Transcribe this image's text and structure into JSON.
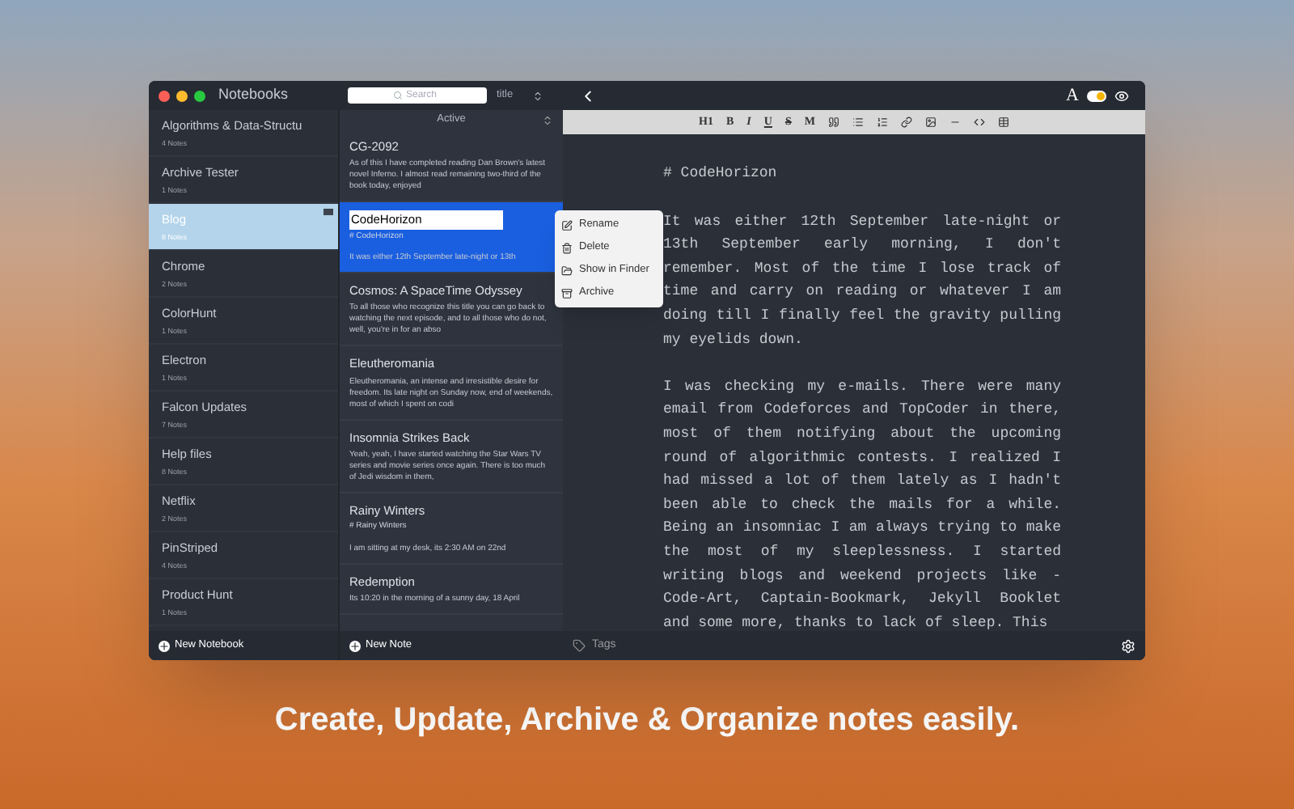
{
  "window": {
    "title": "Notebooks"
  },
  "search": {
    "placeholder": "Search"
  },
  "sort": {
    "value": "title"
  },
  "filter": {
    "value": "Active"
  },
  "notebooks": [
    {
      "name": "Algorithms & Data-Structu",
      "count": "4 Notes",
      "selected": false
    },
    {
      "name": "Archive Tester",
      "count": "1 Notes",
      "selected": false
    },
    {
      "name": "Blog",
      "count": "8 Notes",
      "selected": true
    },
    {
      "name": "Chrome",
      "count": "2 Notes",
      "selected": false
    },
    {
      "name": "ColorHunt",
      "count": "1 Notes",
      "selected": false
    },
    {
      "name": "Electron",
      "count": "1 Notes",
      "selected": false
    },
    {
      "name": "Falcon Updates",
      "count": "7 Notes",
      "selected": false
    },
    {
      "name": "Help files",
      "count": "8 Notes",
      "selected": false
    },
    {
      "name": "Netflix",
      "count": "2 Notes",
      "selected": false
    },
    {
      "name": "PinStriped",
      "count": "4 Notes",
      "selected": false
    },
    {
      "name": "Product Hunt",
      "count": "1 Notes",
      "selected": false
    }
  ],
  "new_notebook": "New Notebook",
  "notes": [
    {
      "title": "CG-2092",
      "preview": "As of this  I have completed reading Dan Brown's latest novel Inferno. I almost read remaining two-third of the book today, enjoyed",
      "selected": false
    },
    {
      "title": "CodeHorizon",
      "heading": "# CodeHorizon",
      "preview": "It was either 12th September late-night or 13th",
      "selected": true
    },
    {
      "title": "Cosmos: A SpaceTime Odyssey",
      "preview": "To all those who recognize this title you can go back to watching the next episode, and to all those who do not, well, you're in for an abso",
      "selected": false
    },
    {
      "title": "Eleutheromania",
      "preview": "Eleutheromania, an intense and irresistible desire for freedom. Its late night on Sunday now, end of weekends, most of which I spent on codi",
      "selected": false
    },
    {
      "title": "Insomnia Strikes Back",
      "preview": "Yeah, yeah, I have started watching the Star Wars TV series and movie series once again. There is too much of Jedi wisdom in them,",
      "selected": false
    },
    {
      "title": "Rainy Winters",
      "heading": "# Rainy Winters",
      "preview": "I am sitting at my desk, its 2:30 AM on 22nd",
      "selected": false
    },
    {
      "title": "Redemption",
      "preview": "Its 10:20 in the morning of a sunny day, 18 April",
      "selected": false
    }
  ],
  "new_note": "New Note",
  "context_menu": [
    {
      "label": "Rename"
    },
    {
      "label": "Delete"
    },
    {
      "label": "Show in Finder"
    },
    {
      "label": "Archive"
    }
  ],
  "format_toolbar": [
    "H1",
    "B",
    "I",
    "U",
    "S",
    "M"
  ],
  "editor": {
    "heading": "# CodeHorizon",
    "paragraphs": [
      "It was either 12th September late-night or 13th September early morning, I don't remember. Most of the time I lose track of time and carry on reading or whatever I am doing till I finally feel the gravity pulling my eyelids down.",
      "I was checking my e-mails. There were many email from Codeforces and TopCoder in there, most of them notifying about the upcoming round of algorithmic contests. I realized I had missed a lot of them lately as I hadn't been able to check the mails for a while. Being an insomniac I am always trying to make the most of my sleeplessness. I started writing blogs and weekend projects like - Code-Art, Captain-Bookmark, Jekyll Booklet and some more, thanks to lack of sleep. This"
    ]
  },
  "font_toggle": {
    "label": "A",
    "on": true
  },
  "tags": {
    "placeholder": "Tags"
  },
  "caption": "Create, Update, Archive & Organize notes easily."
}
